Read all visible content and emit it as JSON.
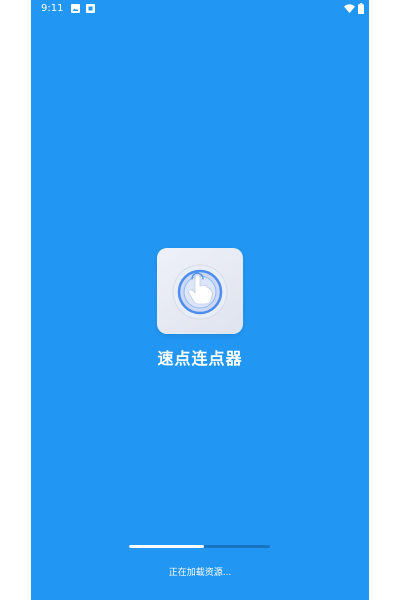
{
  "status_bar": {
    "time": "9:11",
    "icons": [
      "image-icon",
      "notification-box-icon",
      "wifi-icon",
      "battery-icon"
    ]
  },
  "app": {
    "name": "速点连点器",
    "icon": "hand-tap-icon"
  },
  "loading": {
    "text": "正在加载资源...",
    "progress": 0.53
  },
  "colors": {
    "background": "#2196f3",
    "progress_track": "#1775c4",
    "progress_fill": "#ffffff",
    "text": "#ffffff"
  }
}
